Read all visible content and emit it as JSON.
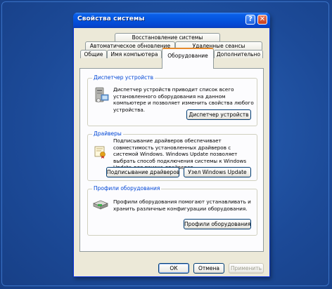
{
  "window": {
    "title": "Свойства системы"
  },
  "tabs": {
    "row1": [
      {
        "label": "Восстановление системы"
      }
    ],
    "row2": [
      {
        "label": "Автоматическое обновление"
      },
      {
        "label": "Удаленные сеансы"
      }
    ],
    "row3": [
      {
        "label": "Общие"
      },
      {
        "label": "Имя компьютера"
      },
      {
        "label": "Оборудование"
      },
      {
        "label": "Дополнительно"
      }
    ]
  },
  "groups": {
    "device_manager": {
      "label": "Диспетчер устройств",
      "description": "Диспетчер устройств приводит список всего установленного оборудования на данном компьютере и позволяет изменить свойства любого устройства.",
      "button": "Диспетчер устройств",
      "icon": "device-manager-icon"
    },
    "drivers": {
      "label": "Драйверы",
      "description": "Подписывание драйверов обеспечивает совместимость установленных драйверов с системой Windows. Windows Update позволяет выбрать способ подключения системы к Windows Update для поиска драйверов.",
      "button_signing": "Подписывание драйверов",
      "button_update": "Узел Windows Update",
      "icon": "driver-certificate-icon"
    },
    "profiles": {
      "label": "Профили оборудования",
      "description": "Профили оборудования помогают устанавливать и хранить различные конфигурации оборудования.",
      "button": "Профили оборудования",
      "icon": "hardware-profiles-icon"
    }
  },
  "footer": {
    "ok": "ОК",
    "cancel": "Отмена",
    "apply": "Применить"
  },
  "colors": {
    "desktop": "#1e4f9e",
    "titlebar": "#0453dd",
    "active_tab_accent": "#e68b2c",
    "group_label": "#0046d5"
  }
}
